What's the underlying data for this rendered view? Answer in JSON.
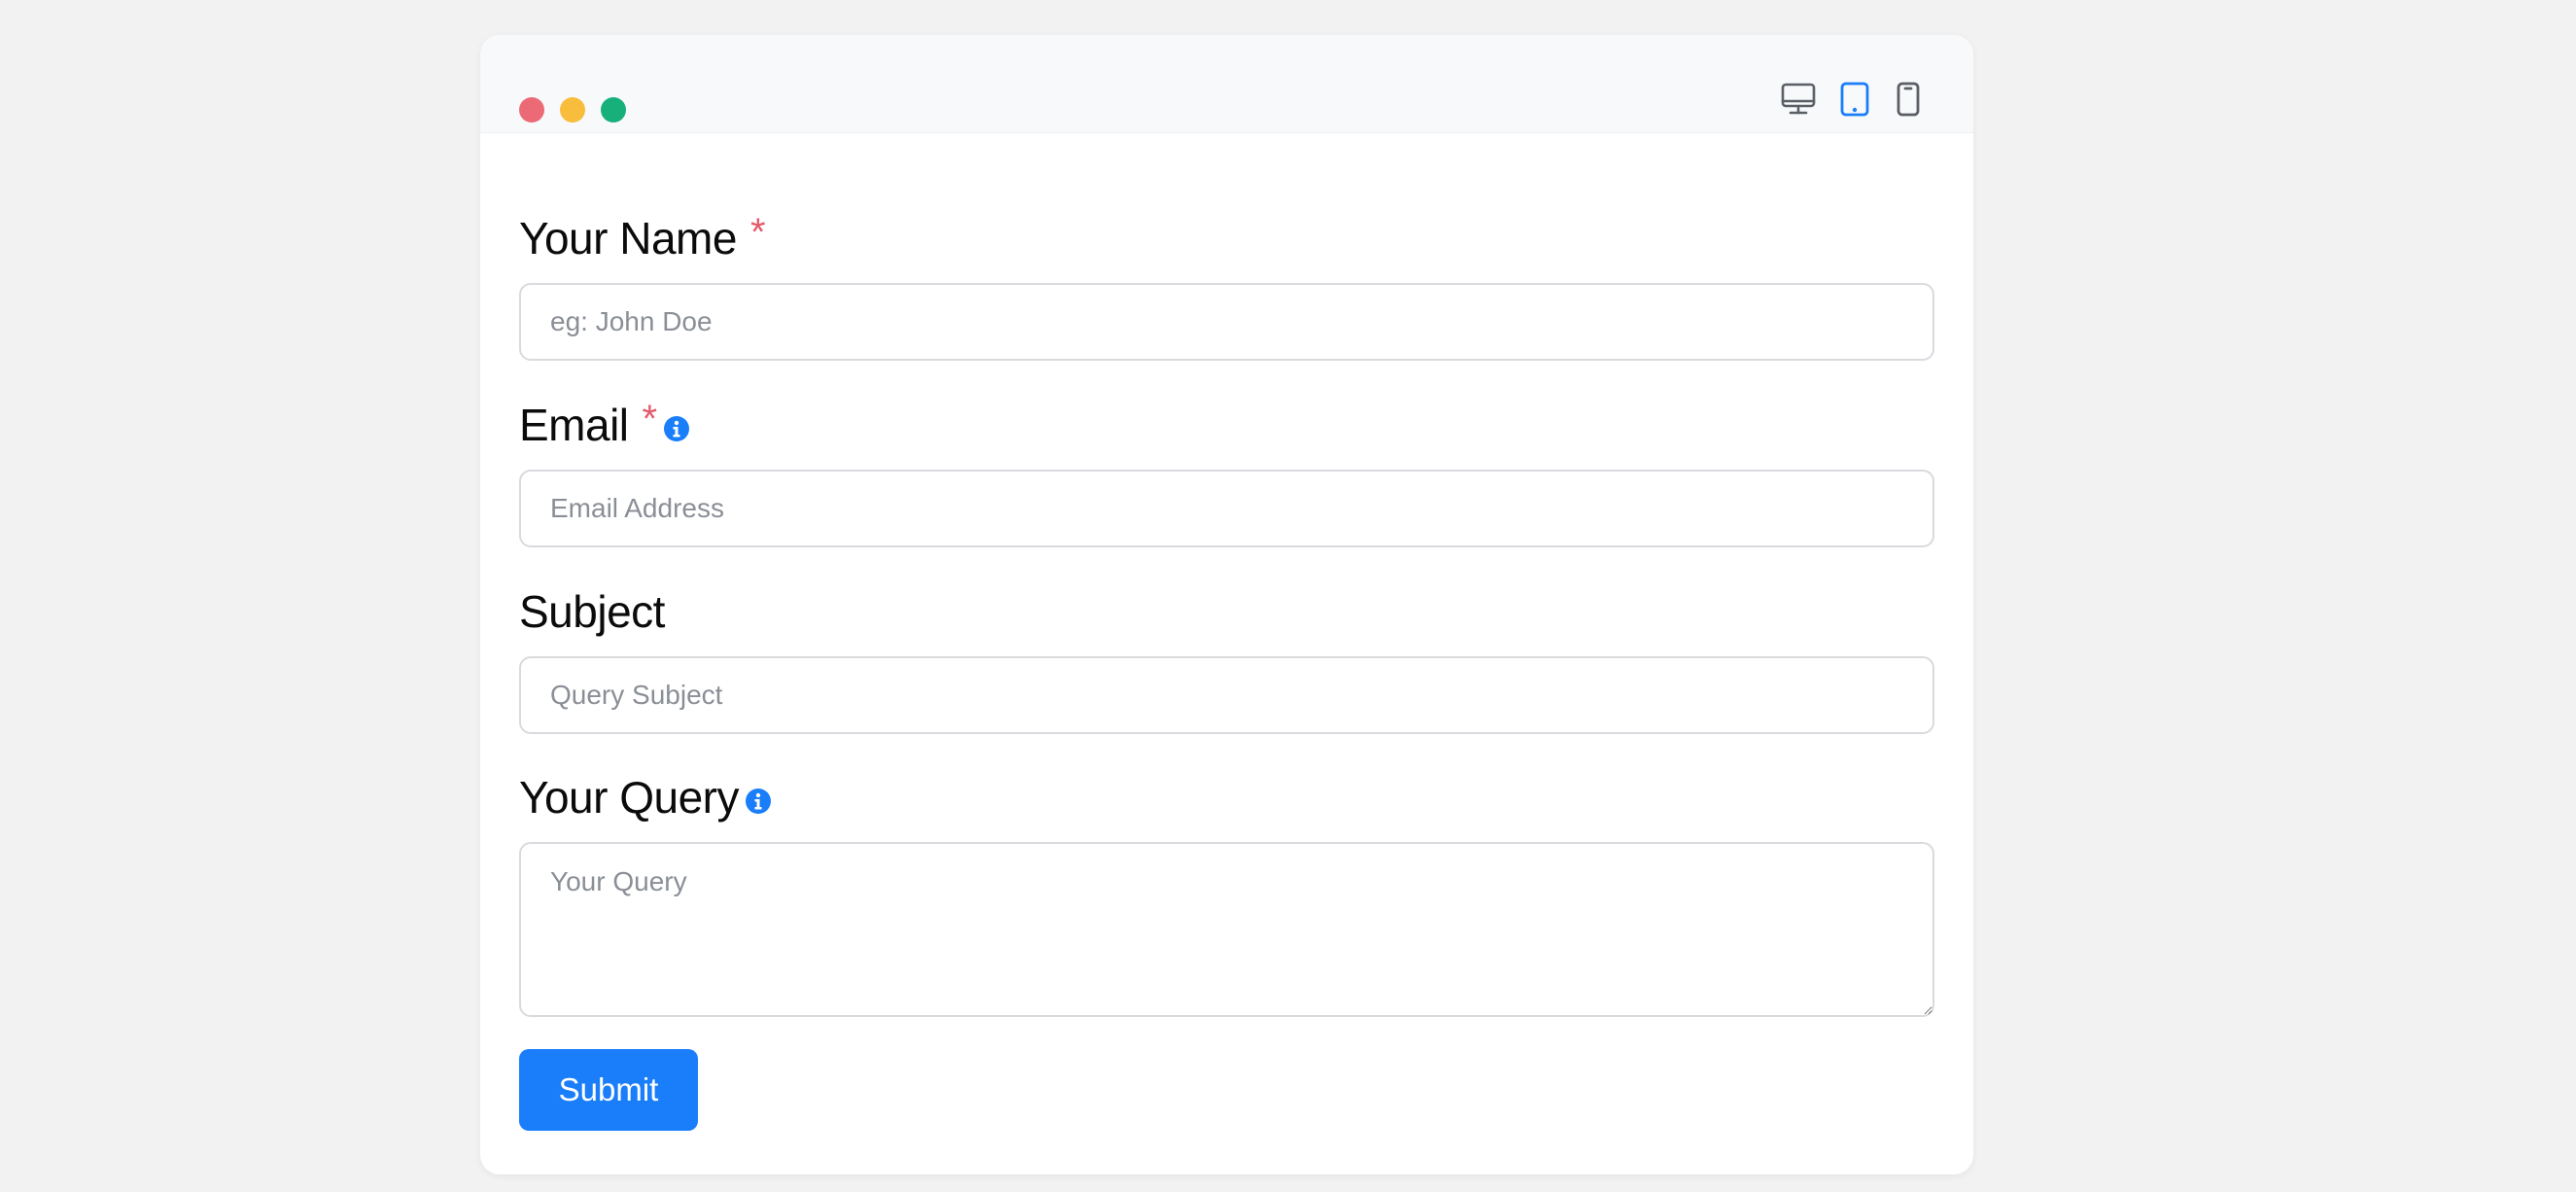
{
  "window": {
    "controls": {
      "close_color": "#ec6a76",
      "minimize_color": "#f8bd3c",
      "maximize_color": "#17b07a"
    },
    "device_toggle": {
      "options": [
        "desktop-icon",
        "tablet-icon",
        "mobile-icon"
      ],
      "selected": "tablet-icon",
      "active_color": "#1a7efb",
      "inactive_color": "#5a5f66"
    }
  },
  "form": {
    "fields": [
      {
        "label": "Your Name",
        "required_mark": "*",
        "placeholder": "eg: John Doe"
      },
      {
        "label": "Email",
        "required_mark": "*",
        "placeholder": "Email Address"
      },
      {
        "label": "Subject",
        "placeholder": "Query Subject"
      },
      {
        "label": "Your Query",
        "placeholder": "Your Query"
      }
    ],
    "submit_label": "Submit",
    "accent_color": "#1a7efb",
    "required_color": "#e45a6a"
  }
}
